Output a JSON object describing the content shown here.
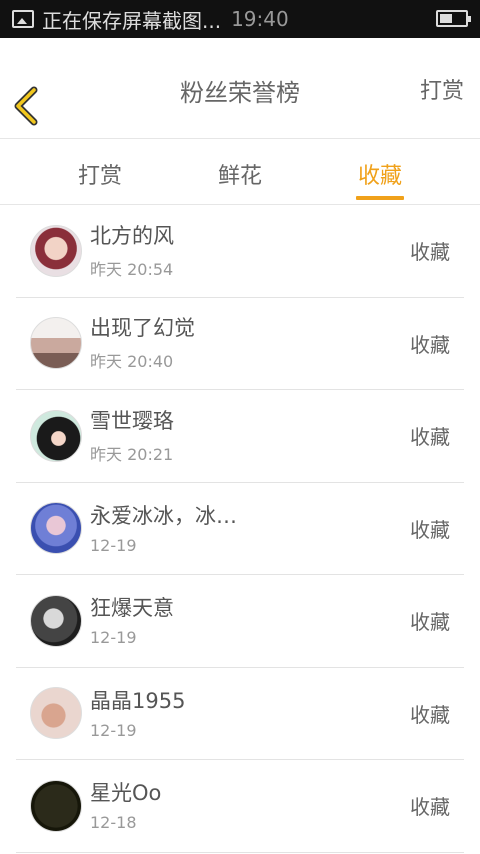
{
  "status_bar": {
    "notification": "正在保存屏幕截图...",
    "time": "19:40"
  },
  "header": {
    "title": "粉丝荣誉榜",
    "action": "打赏"
  },
  "tabs": [
    {
      "label": "打赏"
    },
    {
      "label": "鲜花"
    },
    {
      "label": "收藏"
    }
  ],
  "active_tab": "收藏",
  "list": [
    {
      "name": "北方的风",
      "time": "昨天 20:54",
      "action": "收藏"
    },
    {
      "name": "出现了幻觉",
      "time": "昨天 20:40",
      "action": "收藏"
    },
    {
      "name": "雪世璎珞",
      "time": "昨天 20:21",
      "action": "收藏"
    },
    {
      "name": "永爱冰冰，冰…",
      "time": "12-19",
      "action": "收藏"
    },
    {
      "name": "狂爆天意",
      "time": "12-19",
      "action": "收藏"
    },
    {
      "name": "晶晶1955",
      "time": "12-19",
      "action": "收藏"
    },
    {
      "name": "星光Oo",
      "time": "12-18",
      "action": "收藏"
    }
  ],
  "colors": {
    "accent": "#f0a11a",
    "status_bar_bg": "#111111"
  },
  "icons": {
    "back": "chevron-left-icon",
    "screenshot": "image-icon",
    "battery": "battery-icon"
  }
}
